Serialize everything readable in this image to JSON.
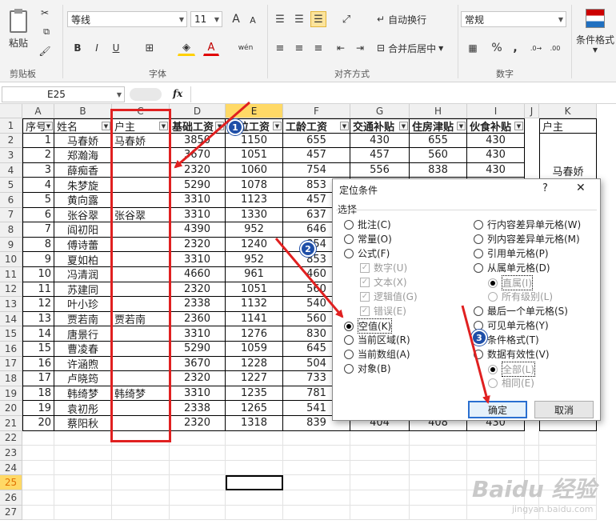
{
  "ribbon": {
    "clipboard": {
      "paste_label": "粘贴",
      "group_label": "剪贴板"
    },
    "font": {
      "family": "等线",
      "size": "11",
      "bold": "B",
      "italic": "I",
      "underline": "U",
      "grow": "A",
      "shrink": "A",
      "group_label": "字体",
      "wen": "wén"
    },
    "align": {
      "wrap_label": "自动换行",
      "merge_label": "合并后居中",
      "group_label": "对齐方式"
    },
    "number": {
      "format": "常规",
      "percent": "%",
      "comma": ",",
      "group_label": "数字"
    },
    "styles": {
      "cond_label": "条件格式"
    }
  },
  "formula_bar": {
    "name_box": "E25",
    "fx": "fx",
    "value": ""
  },
  "columns": [
    "A",
    "B",
    "C",
    "D",
    "E",
    "F",
    "G",
    "H",
    "I",
    "J",
    "K"
  ],
  "active_column": "E",
  "active_row": "25",
  "row_numbers": [
    "1",
    "2",
    "3",
    "4",
    "5",
    "6",
    "7",
    "8",
    "9",
    "10",
    "11",
    "12",
    "13",
    "14",
    "15",
    "16",
    "17",
    "18",
    "19",
    "20",
    "21",
    "22",
    "23",
    "24",
    "25",
    "26",
    "27"
  ],
  "headers": [
    "序号",
    "姓名",
    "户主",
    "基础工资",
    "岗位工资",
    "工龄工资",
    "交通补贴",
    "住房津贴",
    "伙食补贴"
  ],
  "k_header": "户主",
  "k_value": "马春娇",
  "rows": [
    [
      "1",
      "马春娇",
      "马春娇",
      "3850",
      "1150",
      "655",
      "430",
      "655",
      "430"
    ],
    [
      "2",
      "郑瀚海",
      "",
      "3670",
      "1051",
      "457",
      "457",
      "560",
      "430"
    ],
    [
      "3",
      "薛痴香",
      "",
      "2320",
      "1060",
      "754",
      "556",
      "838",
      "430"
    ],
    [
      "4",
      "朱梦旋",
      "",
      "5290",
      "1078",
      "853",
      "",
      "",
      ""
    ],
    [
      "5",
      "黄向露",
      "",
      "3310",
      "1123",
      "457",
      "",
      "",
      ""
    ],
    [
      "6",
      "张谷翠",
      "张谷翠",
      "3310",
      "1330",
      "637",
      "",
      "",
      ""
    ],
    [
      "7",
      "阎初阳",
      "",
      "4390",
      "952",
      "646",
      "",
      "",
      ""
    ],
    [
      "8",
      "傅诗蕾",
      "",
      "2320",
      "1240",
      "854",
      "",
      "",
      ""
    ],
    [
      "9",
      "夏如柏",
      "",
      "3310",
      "952",
      "853",
      "",
      "",
      ""
    ],
    [
      "10",
      "冯清润",
      "",
      "4660",
      "961",
      "460",
      "",
      "",
      ""
    ],
    [
      "11",
      "苏建同",
      "",
      "2320",
      "1051",
      "560",
      "",
      "",
      ""
    ],
    [
      "12",
      "叶小珍",
      "",
      "2338",
      "1132",
      "540",
      "",
      "",
      ""
    ],
    [
      "13",
      "贾若南",
      "贾若南",
      "2360",
      "1141",
      "560",
      "",
      "",
      ""
    ],
    [
      "14",
      "唐景行",
      "",
      "3310",
      "1276",
      "830",
      "",
      "",
      ""
    ],
    [
      "15",
      "曹凌春",
      "",
      "5290",
      "1059",
      "645",
      "",
      "",
      ""
    ],
    [
      "16",
      "许涵煦",
      "",
      "3670",
      "1228",
      "504",
      "",
      "",
      ""
    ],
    [
      "17",
      "卢晓筠",
      "",
      "2320",
      "1227",
      "733",
      "",
      "",
      ""
    ],
    [
      "18",
      "韩绮梦",
      "韩绮梦",
      "3310",
      "1235",
      "781",
      "",
      "",
      ""
    ],
    [
      "19",
      "袁初彤",
      "",
      "2338",
      "1265",
      "541",
      "",
      "",
      ""
    ],
    [
      "20",
      "蔡阳秋",
      "",
      "2320",
      "1318",
      "839",
      "404",
      "408",
      "430"
    ]
  ],
  "dialog": {
    "title": "定位条件",
    "help": "?",
    "close": "✕",
    "section": "选择",
    "left_options": [
      "批注(C)",
      "常量(O)",
      "公式(F)"
    ],
    "formula_sub": [
      "数字(U)",
      "文本(X)",
      "逻辑值(G)",
      "错误(E)"
    ],
    "left_options2": [
      "空值(K)",
      "当前区域(R)",
      "当前数组(A)",
      "对象(B)"
    ],
    "right_options": [
      "行内容差异单元格(W)",
      "列内容差异单元格(M)",
      "引用单元格(P)",
      "从属单元格(D)"
    ],
    "right_sub": [
      "直属(I)",
      "所有级别(L)"
    ],
    "right_options2": [
      "最后一个单元格(S)",
      "可见单元格(Y)",
      "条件格式(T)",
      "数据有效性(V)"
    ],
    "right_sub2": [
      "全部(L)",
      "相同(E)"
    ],
    "selected": "空值(K)",
    "ok": "确定",
    "cancel": "取消"
  },
  "badges": [
    "1",
    "2",
    "3"
  ],
  "watermark": {
    "line1": "Baidu 经验",
    "line2": "jingyan.baidu.com"
  },
  "colors": {
    "accent_red": "#e02020",
    "badge_blue": "#1f4fa8",
    "active_header": "#ffd966"
  }
}
